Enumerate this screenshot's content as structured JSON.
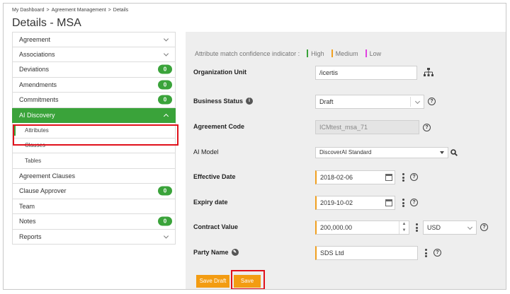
{
  "breadcrumb": [
    "My Dashboard",
    ">",
    "Agreement Management",
    ">",
    "Details"
  ],
  "page_title": "Details - MSA",
  "sidebar": {
    "items": [
      {
        "label": "Agreement",
        "chevron": "down"
      },
      {
        "label": "Associations",
        "chevron": "down"
      },
      {
        "label": "Deviations",
        "badge": "0"
      },
      {
        "label": "Amendments",
        "badge": "0"
      },
      {
        "label": "Commitments",
        "badge": "0"
      },
      {
        "label": "AI Discovery",
        "chevron": "up",
        "active": true
      },
      {
        "label": "Attributes",
        "sub": true,
        "selected": true
      },
      {
        "label": "Clauses",
        "sub": true
      },
      {
        "label": "Tables",
        "sub": true
      },
      {
        "label": "Agreement Clauses"
      },
      {
        "label": "Clause Approver",
        "badge": "0"
      },
      {
        "label": "Team"
      },
      {
        "label": "Notes",
        "badge": "0"
      },
      {
        "label": "Reports",
        "chevron": "down"
      }
    ]
  },
  "legend": {
    "label": "Attribute match confidence indicator :",
    "high": "High",
    "medium": "Medium",
    "low": "Low",
    "colors": {
      "high": "#3aa33a",
      "medium": "#f0a020",
      "low": "#e040e0"
    }
  },
  "form": {
    "org_unit": {
      "label": "Organization Unit",
      "value": "/icertis",
      "icon": "hierarchy-icon"
    },
    "business_status": {
      "label": "Business Status",
      "value": "Draft"
    },
    "agreement_code": {
      "label": "Agreement Code",
      "value": "ICMtest_msa_71"
    },
    "ai_model": {
      "label": "AI Model",
      "value": "DiscoverAI Standard"
    },
    "effective_date": {
      "label": "Effective Date",
      "value": "2018-02-06"
    },
    "expiry_date": {
      "label": "Expiry date",
      "value": "2019-10-02"
    },
    "contract_value": {
      "label": "Contract Value",
      "value": "200,000.00",
      "currency": "USD"
    },
    "party_name": {
      "label": "Party Name",
      "value": "SDS Ltd"
    }
  },
  "buttons": {
    "save_draft": "Save Draft",
    "save": "Save"
  }
}
